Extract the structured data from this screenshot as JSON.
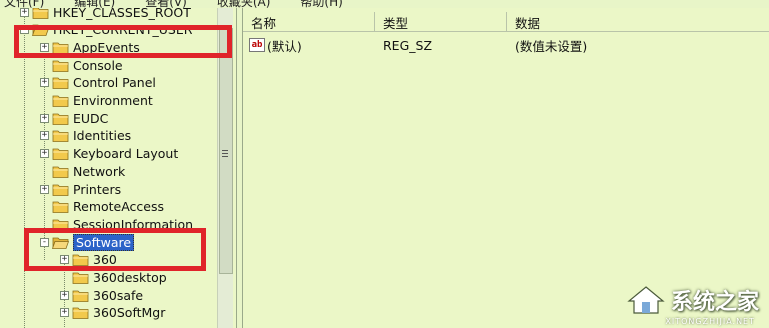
{
  "menubar": {
    "items": [
      "文件(F)",
      "编辑(E)",
      "查看(V)",
      "收藏夹(A)",
      "帮助(H)"
    ]
  },
  "tree": {
    "items": [
      {
        "label": "HKEY_CLASSES_ROOT",
        "expander": "+",
        "level": 0
      },
      {
        "label": "HKEY_CURRENT_USER",
        "expander": "-",
        "level": 0
      },
      {
        "label": "AppEvents",
        "expander": "+",
        "level": 1
      },
      {
        "label": "Console",
        "expander": "",
        "level": 1
      },
      {
        "label": "Control Panel",
        "expander": "+",
        "level": 1
      },
      {
        "label": "Environment",
        "expander": "",
        "level": 1
      },
      {
        "label": "EUDC",
        "expander": "+",
        "level": 1
      },
      {
        "label": "Identities",
        "expander": "+",
        "level": 1
      },
      {
        "label": "Keyboard Layout",
        "expander": "+",
        "level": 1
      },
      {
        "label": "Network",
        "expander": "",
        "level": 1
      },
      {
        "label": "Printers",
        "expander": "+",
        "level": 1
      },
      {
        "label": "RemoteAccess",
        "expander": "",
        "level": 1
      },
      {
        "label": "SessionInformation",
        "expander": "",
        "level": 1
      },
      {
        "label": "Software",
        "expander": "-",
        "level": 1,
        "selected": true
      },
      {
        "label": "360",
        "expander": "+",
        "level": 2
      },
      {
        "label": "360desktop",
        "expander": "",
        "level": 2
      },
      {
        "label": "360safe",
        "expander": "+",
        "level": 2
      },
      {
        "label": "360SoftMgr",
        "expander": "+",
        "level": 2
      }
    ]
  },
  "list": {
    "columns": [
      "名称",
      "类型",
      "数据"
    ],
    "rows": [
      {
        "name": "(默认)",
        "type": "REG_SZ",
        "data": "(数值未设置)",
        "icon": "ab"
      }
    ]
  },
  "watermark": {
    "text": "系统之家",
    "subtext": "XITONGZHIJIA.NET"
  },
  "colors": {
    "background": "#e8f5c8",
    "highlight": "#e0242a",
    "selection": "#2b63c8",
    "folder": "#f2c94c"
  }
}
